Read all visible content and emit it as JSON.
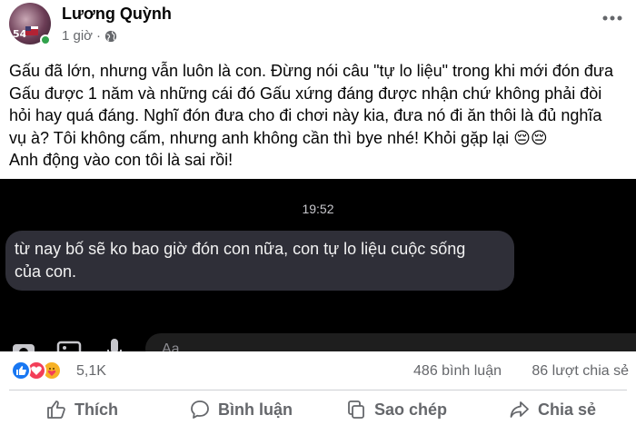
{
  "post": {
    "author": "Lương Quỳnh",
    "time": "1 giờ",
    "text_lines": [
      "Gấu đã lớn, nhưng vẫn luôn là con. Đừng nói câu \"tự lo liệu\" trong khi mới đón đưa",
      "Gấu được 1 năm và những cái đó Gấu xứng đáng được nhận chứ không phải đòi",
      "hỏi hay quá đáng. Nghĩ đón đưa cho đi chơi này kia, đưa nó đi ăn thôi là đủ nghĩa",
      "vụ à? Tôi không cấm, nhưng anh không cần thì bye nhé! Khỏi gặp lại 😔😔",
      "Anh động vào con tôi là sai rồi!"
    ],
    "avatar_badge": "54"
  },
  "chat": {
    "time": "19:52",
    "message_line1": "từ nay bố sẽ ko bao giờ đón con nữa, con tự lo liệu cuộc sống",
    "message_line2": "của con.",
    "input_placeholder": "Aa"
  },
  "stats": {
    "reactions_count": "5,1K",
    "comments": "486 bình luận",
    "shares": "86 lượt chia sẻ"
  },
  "actions": {
    "like": "Thích",
    "comment": "Bình luận",
    "copy": "Sao chép",
    "share": "Chia sẻ"
  },
  "colors": {
    "accent": "#1877f2",
    "secondary_text": "#65676b",
    "online": "#31a24c",
    "chat_bg": "#000000",
    "bubble": "#2f2f38"
  }
}
